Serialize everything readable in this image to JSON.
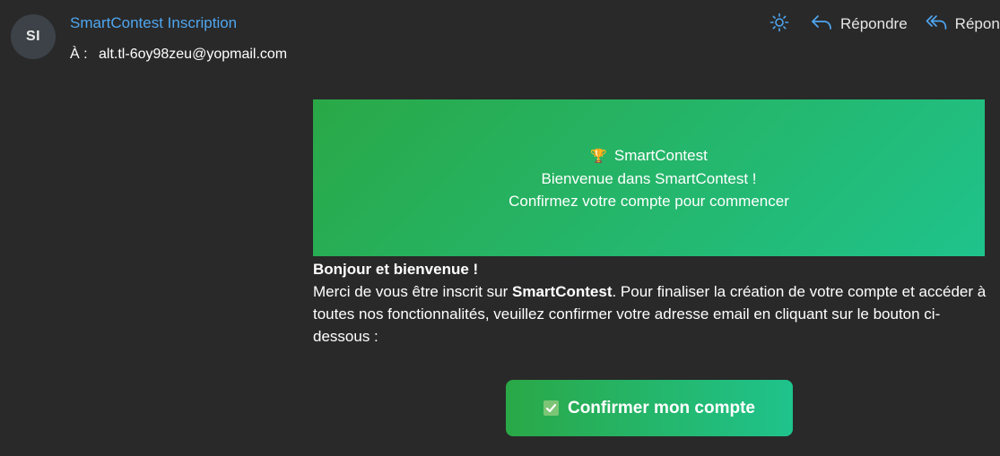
{
  "header": {
    "avatar_initials": "SI",
    "sender_name": "SmartContest Inscription",
    "to_label": "À :",
    "to_address": "alt.tl-6oy98zeu@yopmail.com",
    "actions": {
      "theme_icon": "sun-icon",
      "reply_label": "Répondre",
      "reply_all_label": "Répon"
    },
    "link_color": "#4fa6f0"
  },
  "email": {
    "banner": {
      "icon": "🏆",
      "brand": "SmartContest",
      "welcome": "Bienvenue dans SmartContest !",
      "subtitle": "Confirmez votre compte pour commencer"
    },
    "greeting": "Bonjour et bienvenue !",
    "paragraph": {
      "before": "Merci de vous être inscrit sur ",
      "brand": "SmartContest",
      "after": ". Pour finaliser la création de votre compte et accéder à toutes nos fonctionnalités, veuillez confirmer votre adresse email en cliquant sur le bouton ci-dessous :"
    },
    "confirm_button_label": "Confirmer mon compte",
    "accent_color": "#2aa847",
    "accent_color_end": "#1fc38c"
  }
}
